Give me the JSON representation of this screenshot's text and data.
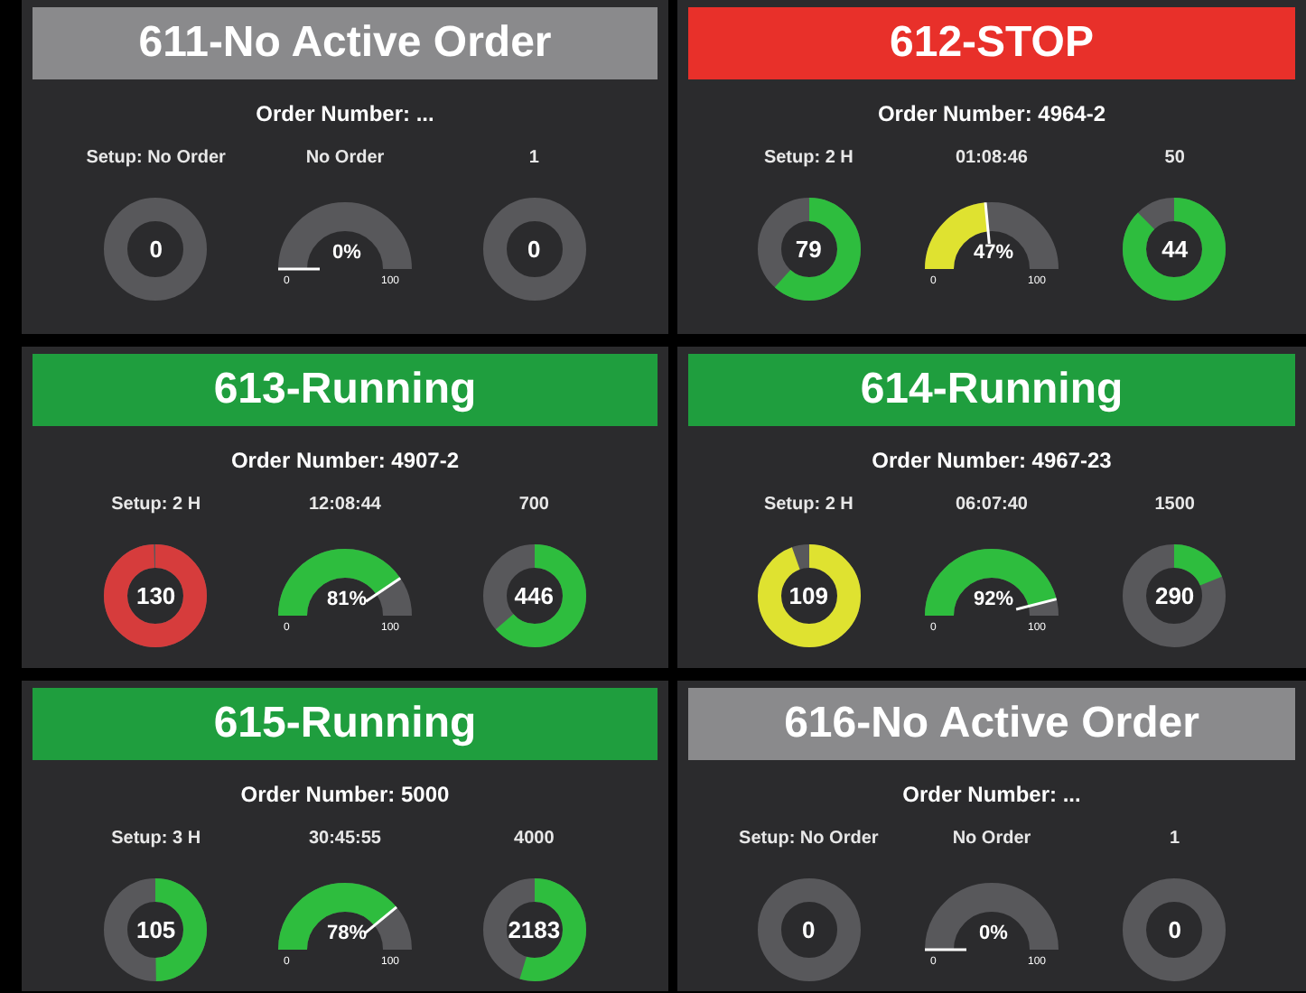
{
  "panels": [
    {
      "title": "611-No Active Order",
      "color": "#8a8a8c",
      "order_number": "Order Number: ...",
      "setup": {
        "label": "Setup: No Order",
        "value": "0"
      },
      "timer": {
        "label": "No Order",
        "reading": "0%",
        "min_label": "0",
        "max_label": "100"
      },
      "count": {
        "label": "1",
        "value": "0"
      }
    },
    {
      "title": "612-STOP",
      "color": "#e8302a",
      "order_number": "Order Number: 4964-2",
      "setup": {
        "label": "Setup: 2 H",
        "value": "79",
        "color": "#2ebd3e"
      },
      "timer": {
        "label": "01:08:46",
        "reading": "47%",
        "color": "#dfe230",
        "min_label": "0",
        "max_label": "100"
      },
      "count": {
        "label": "50",
        "value": "44",
        "color": "#2ebd3e"
      }
    },
    {
      "title": "613-Running",
      "color": "#1f9e3e",
      "order_number": "Order Number: 4907-2",
      "setup": {
        "label": "Setup: 2 H",
        "value": "130",
        "color": "#d63c3c"
      },
      "timer": {
        "label": "12:08:44",
        "reading": "81%",
        "color": "#2ebd3e",
        "min_label": "0",
        "max_label": "100"
      },
      "count": {
        "label": "700",
        "value": "446",
        "color": "#2ebd3e"
      }
    },
    {
      "title": "614-Running",
      "color": "#1f9e3e",
      "order_number": "Order Number: 4967-23",
      "setup": {
        "label": "Setup: 2 H",
        "value": "109",
        "color": "#dfe230"
      },
      "timer": {
        "label": "06:07:40",
        "reading": "92%",
        "color": "#2ebd3e",
        "min_label": "0",
        "max_label": "100"
      },
      "count": {
        "label": "1500",
        "value": "290",
        "color": "#2ebd3e"
      }
    },
    {
      "title": "615-Running",
      "color": "#1f9e3e",
      "order_number": "Order Number: 5000",
      "setup": {
        "label": "Setup: 3 H",
        "value": "105",
        "color": "#2ebd3e"
      },
      "timer": {
        "label": "30:45:55",
        "reading": "78%",
        "color": "#2ebd3e",
        "min_label": "0",
        "max_label": "100"
      },
      "count": {
        "label": "4000",
        "value": "2183",
        "color": "#2ebd3e"
      }
    },
    {
      "title": "616-No Active Order",
      "color": "#8a8a8c",
      "order_number": "Order Number: ...",
      "setup": {
        "label": "Setup: No Order",
        "value": "0"
      },
      "timer": {
        "label": "No Order",
        "reading": "0%",
        "min_label": "0",
        "max_label": "100"
      },
      "count": {
        "label": "1",
        "value": "0"
      }
    }
  ]
}
